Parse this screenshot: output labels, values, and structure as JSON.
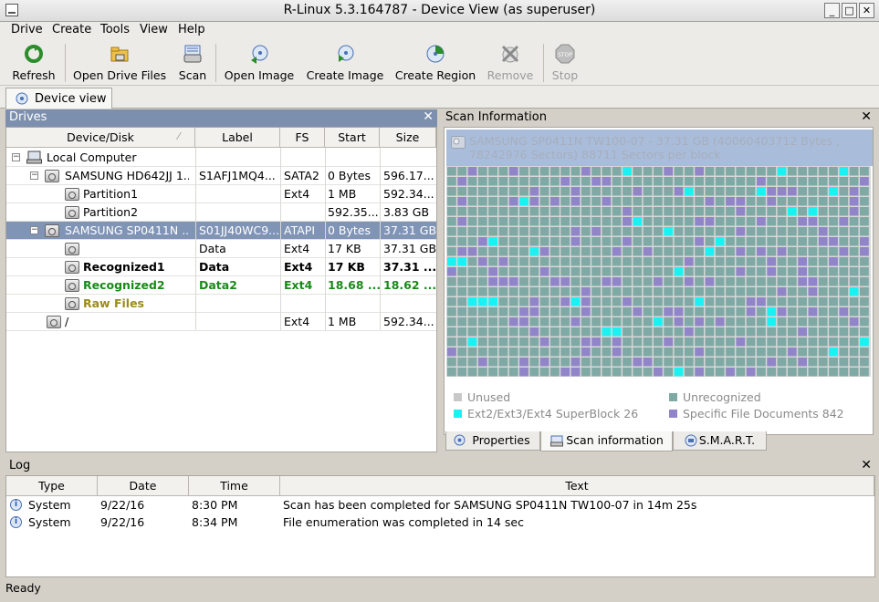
{
  "window": {
    "title": "R-Linux 5.3.164787 - Device View (as superuser)",
    "minimize": "_",
    "maximize": "□",
    "close": "✕"
  },
  "menu": [
    "Drive",
    "Create",
    "Tools",
    "View",
    "Help"
  ],
  "toolbar": [
    {
      "label": "Refresh",
      "icon": "refresh-icon",
      "enabled": true
    },
    {
      "label": "Open Drive Files",
      "icon": "open-drive-files-icon",
      "enabled": true
    },
    {
      "label": "Scan",
      "icon": "scan-icon",
      "enabled": true
    },
    {
      "label": "Open Image",
      "icon": "open-image-icon",
      "enabled": true
    },
    {
      "label": "Create Image",
      "icon": "create-image-icon",
      "enabled": true
    },
    {
      "label": "Create Region",
      "icon": "create-region-icon",
      "enabled": true
    },
    {
      "label": "Remove",
      "icon": "remove-icon",
      "enabled": false
    },
    {
      "label": "Stop",
      "icon": "stop-icon",
      "enabled": false
    }
  ],
  "tabs": {
    "device_view": "Device view"
  },
  "drives": {
    "title": "Drives",
    "close": "✕",
    "columns": [
      "Device/Disk",
      "Label",
      "FS",
      "Start",
      "Size"
    ],
    "rows": [
      {
        "name": "Local Computer",
        "label": "",
        "fs": "",
        "start": "",
        "size": "",
        "style": "normal",
        "expander": "−",
        "icon": "computer-icon"
      },
      {
        "name": "SAMSUNG HD642JJ 1...",
        "label": "S1AFJ1MQ4...",
        "fs": "SATA2",
        "start": "0 Bytes",
        "size": "596.17...",
        "style": "normal",
        "expander": "−",
        "icon": "disk-icon"
      },
      {
        "name": "Partition1",
        "label": "",
        "fs": "Ext4",
        "start": "1 MB",
        "size": "592.34...",
        "style": "normal",
        "expander": "",
        "icon": "partition-icon"
      },
      {
        "name": "Partition2",
        "label": "",
        "fs": "",
        "start": "592.35...",
        "size": "3.83 GB",
        "style": "normal",
        "expander": "",
        "icon": "partition-icon"
      },
      {
        "name": "SAMSUNG SP0411N ...",
        "label": "S01JJ40WC9...",
        "fs": "ATAPI",
        "start": "0 Bytes",
        "size": "37.31 GB",
        "style": "selected",
        "expander": "−",
        "icon": "disk-icon"
      },
      {
        "name": "",
        "label": "Data",
        "fs": "Ext4",
        "start": "17 KB",
        "size": "37.31 GB",
        "style": "normal",
        "expander": "",
        "icon": "partition-icon"
      },
      {
        "name": "Recognized1",
        "label": "Data",
        "fs": "Ext4",
        "start": "17 KB",
        "size": "37.31 ...",
        "style": "bold",
        "expander": "",
        "icon": "partition-icon"
      },
      {
        "name": "Recognized2",
        "label": "Data2",
        "fs": "Ext4",
        "start": "18.68 ...",
        "size": "18.62 ...",
        "style": "green",
        "expander": "",
        "icon": "partition-icon"
      },
      {
        "name": "Raw Files",
        "label": "",
        "fs": "",
        "start": "",
        "size": "",
        "style": "olive",
        "expander": "",
        "icon": "partition-icon"
      },
      {
        "name": "/",
        "label": "",
        "fs": "Ext4",
        "start": "1 MB",
        "size": "592.34...",
        "style": "normal",
        "expander": "",
        "icon": "partition-icon"
      }
    ]
  },
  "scan": {
    "title": "Scan Information",
    "close": "✕",
    "device_line1": "SAMSUNG SP0411N TW100-07 - 37.31 GB (40060403712 Bytes ,",
    "device_line2": "78242976 Sectors) 88711 Sectors per block",
    "legend": [
      {
        "label": "Unused",
        "color": "#c8c8c8"
      },
      {
        "label": "Unrecognized",
        "color": "#7fa9a4"
      },
      {
        "label": "Ext2/Ext3/Ext4 SuperBlock 26",
        "color": "#19f2f2"
      },
      {
        "label": "Specific File Documents 842",
        "color": "#9085c8"
      }
    ],
    "tabs": [
      "Properties",
      "Scan information",
      "S.M.A.R.T."
    ],
    "active_tab": "Scan information"
  },
  "log": {
    "title": "Log",
    "close": "✕",
    "columns": [
      "Type",
      "Date",
      "Time",
      "Text"
    ],
    "rows": [
      {
        "type": "System",
        "date": "9/22/16",
        "time": "8:30 PM",
        "text": "Scan has been completed for SAMSUNG SP0411N TW100-07 in 14m 25s"
      },
      {
        "type": "System",
        "date": "9/22/16",
        "time": "8:34 PM",
        "text": "File enumeration was completed in 14 sec"
      }
    ]
  },
  "status": "Ready",
  "colors": {
    "selection": "#8094b5",
    "drives_header": "#7d8fae",
    "device_box": "#a9bddb",
    "unrecognized": "#7fa9a4",
    "superblock": "#19f2f2",
    "documents": "#9085c8"
  }
}
